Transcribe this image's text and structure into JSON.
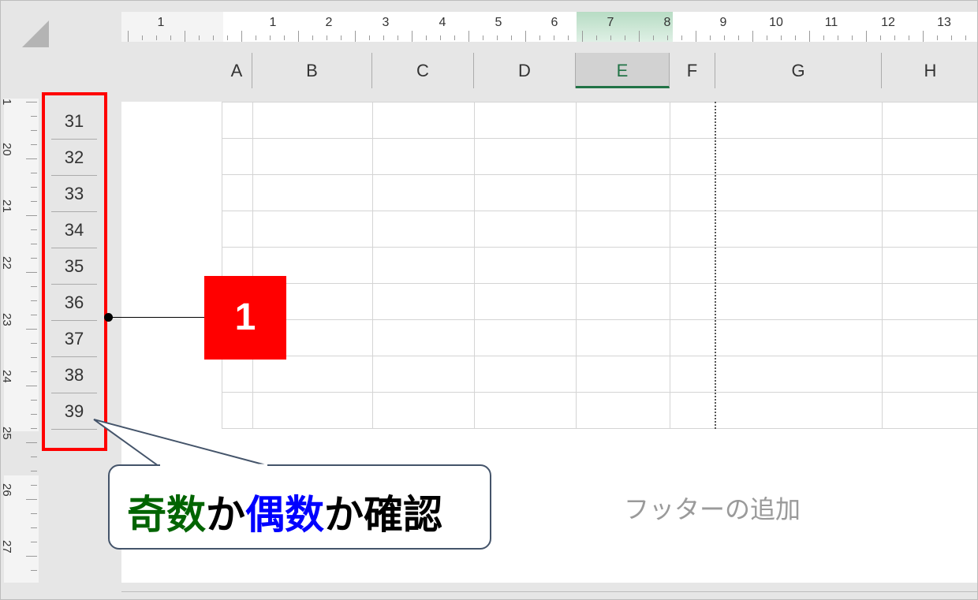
{
  "ruler": {
    "top_labels": [
      "1",
      "1",
      "2",
      "3",
      "4",
      "5",
      "6",
      "7",
      "8",
      "9",
      "10",
      "11",
      "12",
      "13"
    ],
    "left_labels": [
      "1",
      "20",
      "21",
      "22",
      "23",
      "24",
      "25",
      "26",
      "27"
    ]
  },
  "columns": [
    {
      "label": "A",
      "selected": false
    },
    {
      "label": "B",
      "selected": false
    },
    {
      "label": "C",
      "selected": false
    },
    {
      "label": "D",
      "selected": false
    },
    {
      "label": "E",
      "selected": true
    },
    {
      "label": "F",
      "selected": false
    },
    {
      "label": "G",
      "selected": false
    },
    {
      "label": "H",
      "selected": false
    }
  ],
  "rows": [
    "31",
    "32",
    "33",
    "34",
    "35",
    "36",
    "37",
    "38",
    "39"
  ],
  "footer": {
    "label": "フッターの追加"
  },
  "annotation": {
    "badge": "1",
    "callout_part1": "奇数",
    "callout_part2": "か",
    "callout_part3": "偶数",
    "callout_part4": "か確認"
  },
  "colors": {
    "accent_green": "#217346",
    "annotation_red": "#ff0000",
    "odd_green": "#006400",
    "even_blue": "#0000ff"
  }
}
